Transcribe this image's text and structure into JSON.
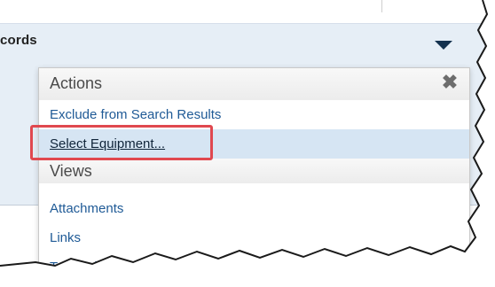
{
  "header": {
    "title": "cords",
    "expand_icon": "caret-down-icon"
  },
  "menu": {
    "close_icon": "close-x-icon",
    "sections": [
      {
        "label": "Actions",
        "items": [
          {
            "label": "Exclude from Search Results",
            "selected": false
          },
          {
            "label": "Select Equipment...",
            "selected": true
          }
        ]
      },
      {
        "label": "Views",
        "items": [
          {
            "label": "Attachments",
            "selected": false
          },
          {
            "label": "Links",
            "selected": false
          },
          {
            "label": "Tracked Is",
            "selected": false
          }
        ]
      }
    ]
  },
  "colors": {
    "link": "#1f5a96",
    "selected_row": "#d6e5f3",
    "highlight": "#e0484f",
    "header_bg": "#e6eef6"
  }
}
